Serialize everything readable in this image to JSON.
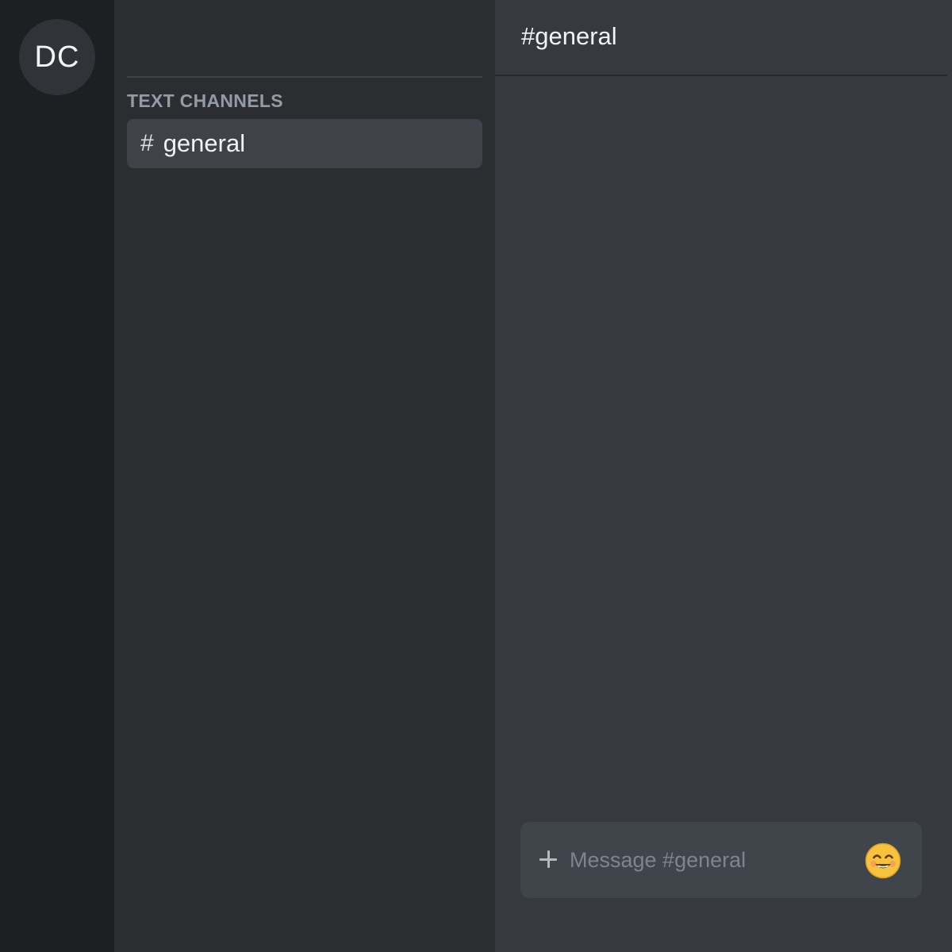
{
  "server_rail": {
    "server_initials": "DC"
  },
  "sidebar": {
    "category_label": "TEXT CHANNELS",
    "channels": [
      {
        "hash": "#",
        "name": "general",
        "selected": true
      }
    ]
  },
  "chat": {
    "title": "#general",
    "composer": {
      "placeholder": "Message #general",
      "value": ""
    }
  },
  "icons": {
    "add": "plus-icon",
    "emoji": "smiling-face-icon"
  },
  "colors": {
    "rail_bg": "#1e1f22",
    "sidebar_bg": "#2b2d31",
    "chat_bg": "#36393f",
    "selected_channel_bg": "#404249",
    "composer_bg": "#40444b",
    "emoji_yellow": "#f7c23c"
  }
}
